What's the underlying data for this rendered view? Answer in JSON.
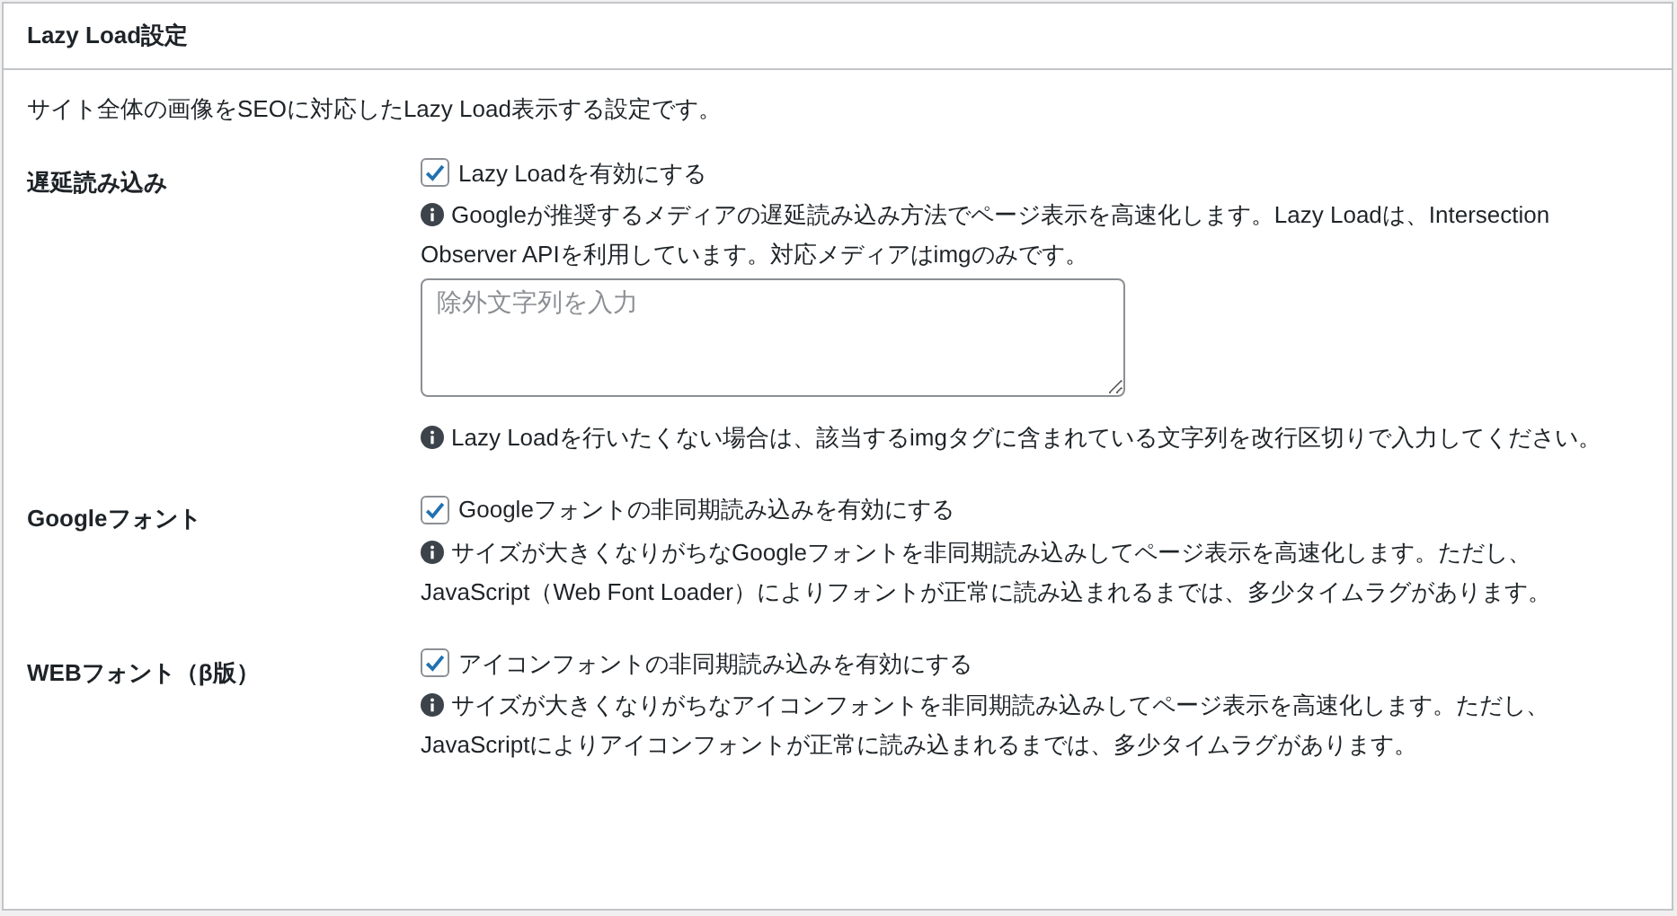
{
  "panel": {
    "title": "Lazy Load設定",
    "description": "サイト全体の画像をSEOに対応したLazy Load表示する設定です。"
  },
  "settings": [
    {
      "label": "遅延読み込み",
      "parts": [
        {
          "kind": "checkbox",
          "label": "Lazy Loadを有効にする",
          "checked": true
        },
        {
          "kind": "note",
          "text": "Googleが推奨するメディアの遅延読み込み方法でページ表示を高速化します。Lazy Loadは、Intersection Observer APIを利用しています。対応メディアはimgのみです。"
        },
        {
          "kind": "textarea",
          "placeholder": "除外文字列を入力"
        },
        {
          "kind": "note",
          "text": "Lazy Loadを行いたくない場合は、該当するimgタグに含まれている文字列を改行区切りで入力してください。"
        }
      ]
    },
    {
      "label": "Googleフォント",
      "parts": [
        {
          "kind": "checkbox",
          "label": "Googleフォントの非同期読み込みを有効にする",
          "checked": true
        },
        {
          "kind": "note",
          "text": "サイズが大きくなりがちなGoogleフォントを非同期読み込みしてページ表示を高速化します。ただし、JavaScript（Web Font Loader）によりフォントが正常に読み込まれるまでは、多少タイムラグがあります。"
        }
      ]
    },
    {
      "label": "WEBフォント（β版）",
      "parts": [
        {
          "kind": "checkbox",
          "label": "アイコンフォントの非同期読み込みを有効にする",
          "checked": true
        },
        {
          "kind": "note",
          "text": "サイズが大きくなりがちなアイコンフォントを非同期読み込みしてページ表示を高速化します。ただし、JavaScriptによりアイコンフォントが正常に読み込まれるまでは、多少タイムラグがあります。"
        }
      ]
    }
  ]
}
